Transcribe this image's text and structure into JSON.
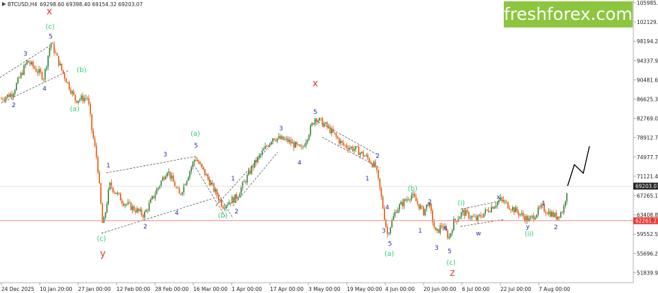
{
  "header": {
    "symbol": "BTCUSD,H4",
    "ohlc": "69298.60 69398.40 69154.32 69203.07"
  },
  "brand": {
    "logo_text": "freshforex.com",
    "bg_color": "#8cc63f"
  },
  "colors": {
    "up_candle": "#2e7d32",
    "down_candle": "#e65100",
    "wave_number": "#1f2fb5",
    "wave_green": "#2ecc71",
    "wave_red": "#e53935",
    "support_line": "#f28b82",
    "price_tag": "#e53935",
    "current_tag": "#222222"
  },
  "chart_data": {
    "type": "candlestick",
    "symbol": "BTCUSD",
    "timeframe": "H4",
    "y_ticks": [
      "105985.50",
      "102129.00",
      "98194.20",
      "94337.95",
      "90481.65",
      "86625.35",
      "82769.00",
      "78912.70",
      "74977.70",
      "71121.45",
      "67265.15",
      "63408.80",
      "59552.50",
      "55696.20",
      "51839.90"
    ],
    "x_ticks": [
      "24 Dec 2025",
      "10 Jan 20:00",
      "27 Jan 00:00",
      "12 Feb 00:00",
      "28 Feb 00:00",
      "16 Mar 00:00",
      "1 Apr 00:00",
      "17 Apr 00:00",
      "3 May 00:00",
      "19 May 00:00",
      "4 Jun 00:00",
      "20 Jun 00:00",
      "6 Jul 00:00",
      "22 Jul 00:00",
      "7 Aug 00:00"
    ],
    "ylim": [
      50500,
      107000
    ],
    "current_price": "69203.07",
    "support_level": "62261.27",
    "price_path": [
      [
        0,
        86625
      ],
      [
        18,
        87800
      ],
      [
        40,
        94300
      ],
      [
        64,
        91000
      ],
      [
        74,
        98200
      ],
      [
        90,
        92500
      ],
      [
        110,
        86500
      ],
      [
        128,
        87000
      ],
      [
        134,
        80500
      ],
      [
        142,
        74000
      ],
      [
        150,
        60800
      ],
      [
        160,
        69500
      ],
      [
        180,
        66000
      ],
      [
        210,
        63400
      ],
      [
        244,
        72500
      ],
      [
        262,
        67300
      ],
      [
        285,
        74977
      ],
      [
        300,
        71500
      ],
      [
        325,
        65300
      ],
      [
        345,
        67000
      ],
      [
        370,
        73500
      ],
      [
        398,
        79000
      ],
      [
        420,
        78300
      ],
      [
        440,
        76500
      ],
      [
        460,
        83000
      ],
      [
        478,
        81000
      ],
      [
        500,
        77500
      ],
      [
        520,
        76500
      ],
      [
        535,
        74977
      ],
      [
        548,
        73000
      ],
      [
        555,
        68000
      ],
      [
        565,
        59552
      ],
      [
        578,
        64500
      ],
      [
        600,
        67500
      ],
      [
        618,
        64000
      ],
      [
        625,
        66000
      ],
      [
        636,
        59552
      ],
      [
        645,
        61500
      ],
      [
        655,
        58800
      ],
      [
        662,
        62000
      ],
      [
        675,
        64000
      ],
      [
        695,
        62500
      ],
      [
        730,
        66500
      ],
      [
        745,
        65000
      ],
      [
        760,
        63500
      ],
      [
        772,
        62300
      ],
      [
        790,
        64900
      ],
      [
        812,
        63000
      ],
      [
        822,
        64500
      ],
      [
        828,
        69203
      ]
    ],
    "projection": [
      [
        828,
        69203
      ],
      [
        838,
        73500
      ],
      [
        851,
        71800
      ],
      [
        860,
        77200
      ]
    ],
    "wave_labels": [
      {
        "t": "x",
        "c": "red"
      },
      {
        "t": "(c)",
        "c": "green"
      },
      {
        "t": "5",
        "c": "blue"
      },
      {
        "t": "3",
        "c": "blue"
      },
      {
        "t": "4",
        "c": "blue"
      },
      {
        "t": "2",
        "c": "blue"
      },
      {
        "t": "(b)",
        "c": "green"
      },
      {
        "t": "(a)",
        "c": "green"
      },
      {
        "t": "1",
        "c": "blue"
      },
      {
        "t": "(c)",
        "c": "green"
      },
      {
        "t": "y",
        "c": "red"
      },
      {
        "t": "2",
        "c": "blue"
      },
      {
        "t": "3",
        "c": "blue"
      },
      {
        "t": "4",
        "c": "blue"
      },
      {
        "t": "(a)",
        "c": "green"
      },
      {
        "t": "5",
        "c": "blue"
      },
      {
        "t": "(b)",
        "c": "green"
      },
      {
        "t": "1",
        "c": "blue"
      },
      {
        "t": "2",
        "c": "blue"
      },
      {
        "t": "3",
        "c": "blue"
      },
      {
        "t": "4",
        "c": "blue"
      },
      {
        "t": "x",
        "c": "red"
      },
      {
        "t": "5",
        "c": "blue"
      },
      {
        "t": "2",
        "c": "blue"
      },
      {
        "t": "1",
        "c": "blue"
      },
      {
        "t": "4",
        "c": "blue"
      },
      {
        "t": "3",
        "c": "blue"
      },
      {
        "t": "5",
        "c": "blue"
      },
      {
        "t": "(a)",
        "c": "green"
      },
      {
        "t": "(b)",
        "c": "green"
      },
      {
        "t": "2",
        "c": "blue"
      },
      {
        "t": "1",
        "c": "blue"
      },
      {
        "t": "3",
        "c": "blue"
      },
      {
        "t": "4",
        "c": "blue"
      },
      {
        "t": "5",
        "c": "blue"
      },
      {
        "t": "(c)",
        "c": "green"
      },
      {
        "t": "z",
        "c": "red"
      },
      {
        "t": "(i)",
        "c": "green"
      },
      {
        "t": "w",
        "c": "blue"
      },
      {
        "t": "x",
        "c": "blue"
      },
      {
        "t": "y",
        "c": "blue"
      },
      {
        "t": "(ii)",
        "c": "green"
      },
      {
        "t": "1",
        "c": "blue"
      },
      {
        "t": "2",
        "c": "blue"
      }
    ]
  }
}
